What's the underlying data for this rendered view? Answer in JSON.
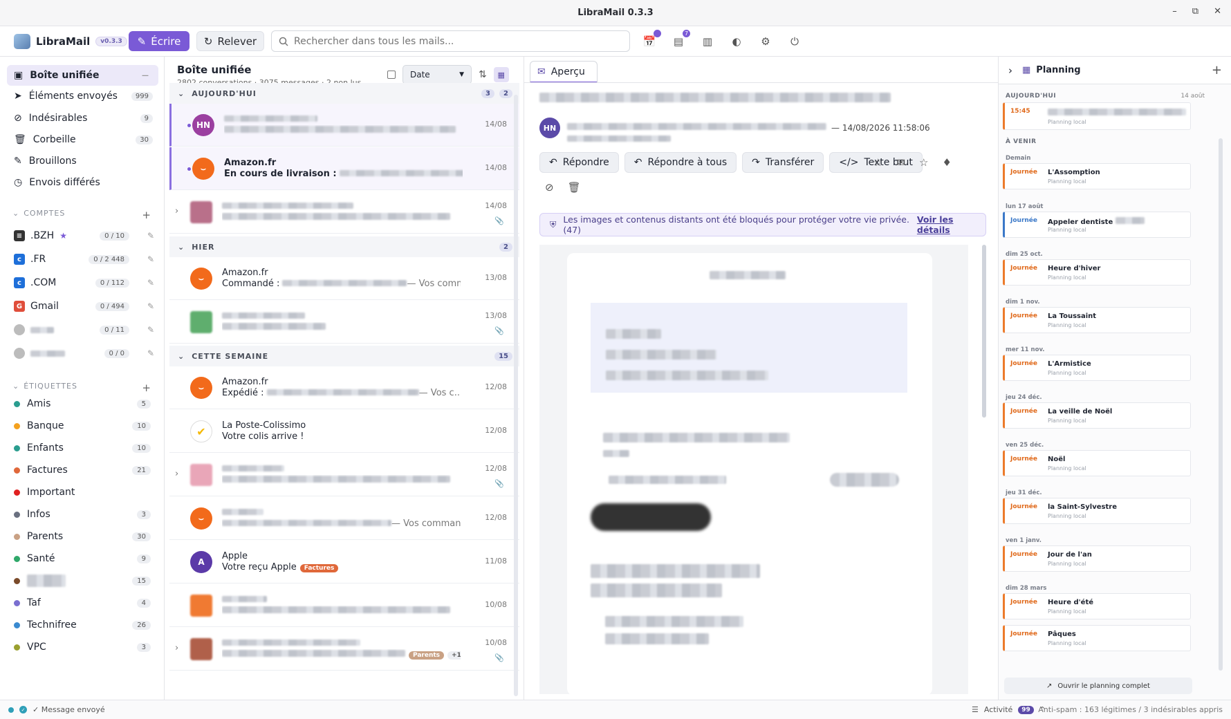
{
  "window": {
    "title": "LibraMail 0.3.3"
  },
  "toolbar": {
    "app_name": "LibraMail",
    "version": "v0.3.3",
    "write_label": "Écrire",
    "fetch_label": "Relever",
    "search_placeholder": "Rechercher dans tous les mails...",
    "calendar_badge": "",
    "tasks_badge": "7"
  },
  "sidebar": {
    "folders": [
      {
        "label": "Boîte unifiée",
        "count": ""
      },
      {
        "label": "Éléments envoyés",
        "count": "999"
      },
      {
        "label": "Indésirables",
        "count": "9"
      },
      {
        "label": "Corbeille",
        "count": "30"
      },
      {
        "label": "Brouillons",
        "count": ""
      },
      {
        "label": "Envois différés",
        "count": ""
      }
    ],
    "accounts_title": "COMPTES",
    "accounts": [
      {
        "label": ".BZH",
        "count": "0 / 10",
        "color": "#333333"
      },
      {
        "label": ".FR",
        "count": "0 / 2 448",
        "color": "#1e6fd9"
      },
      {
        "label": ".COM",
        "count": "0 / 112",
        "color": "#1e6fd9"
      },
      {
        "label": "Gmail",
        "count": "0 / 494",
        "color": "#e04e3b"
      },
      {
        "label": "",
        "count": "0 / 11",
        "color": "#b9b9b9"
      },
      {
        "label": "",
        "count": "0 / 0",
        "color": "#b9b9b9"
      }
    ],
    "labels_title": "ÉTIQUETTES",
    "labels": [
      {
        "label": "Amis",
        "count": "5",
        "color": "#2a9d8f"
      },
      {
        "label": "Banque",
        "count": "10",
        "color": "#f4a11e"
      },
      {
        "label": "Enfants",
        "count": "10",
        "color": "#2a9d8f"
      },
      {
        "label": "Factures",
        "count": "21",
        "color": "#e0683a"
      },
      {
        "label": "Important",
        "count": "",
        "color": "#e02020"
      },
      {
        "label": "Infos",
        "count": "3",
        "color": "#6a7080"
      },
      {
        "label": "Parents",
        "count": "30",
        "color": "#c9a184"
      },
      {
        "label": "Santé",
        "count": "9",
        "color": "#2fa86a"
      },
      {
        "label": "",
        "count": "15",
        "color": "#7a4a2a"
      },
      {
        "label": "Taf",
        "count": "4",
        "color": "#7a6fd0"
      },
      {
        "label": "Technifree",
        "count": "26",
        "color": "#3a8ad0"
      },
      {
        "label": "VPC",
        "count": "3",
        "color": "#9aa030"
      }
    ]
  },
  "list": {
    "title": "Boîte unifiée",
    "subtitle": "2802 conversations · 3075 messages · 2 non lus",
    "sort_label": "Date",
    "groups": [
      {
        "label": "AUJOURD'HUI",
        "count_a": "3",
        "count_b": "2"
      },
      {
        "label": "HIER",
        "count_a": "2"
      },
      {
        "label": "CETTE SEMAINE",
        "count_a": "15"
      }
    ],
    "rows": [
      {
        "initials": "HN",
        "from": "",
        "subject": "",
        "date": "14/08"
      },
      {
        "initials": "",
        "from": "Amazon.fr",
        "subject": "En cours de livraison :",
        "date": "14/08"
      },
      {
        "initials": "",
        "from": "",
        "subject": "",
        "date": "14/08"
      },
      {
        "initials": "",
        "from": "Amazon.fr",
        "subject": "Commandé :",
        "suffix": "— Vos commande...",
        "date": "13/08"
      },
      {
        "initials": "",
        "from": "",
        "subject": "",
        "date": "13/08"
      },
      {
        "initials": "",
        "from": "Amazon.fr",
        "subject": "Expédié :",
        "suffix": "— Vos c...",
        "date": "12/08"
      },
      {
        "initials": "",
        "from": "La Poste-Colissimo",
        "subject": "Votre colis arrive !",
        "date": "12/08"
      },
      {
        "initials": "",
        "from": "",
        "subject": "",
        "date": "12/08"
      },
      {
        "initials": "",
        "from": "",
        "subject": "",
        "suffix": "— Vos commandes ...",
        "date": "12/08"
      },
      {
        "initials": "A",
        "from": "Apple",
        "subject": "Votre reçu Apple",
        "tag": "Factures",
        "date": "11/08"
      },
      {
        "initials": "",
        "from": "",
        "subject": "",
        "date": "10/08"
      },
      {
        "initials": "",
        "from": "",
        "subject": "",
        "tag": "Parents",
        "extra": "+1",
        "date": "10/08"
      }
    ]
  },
  "preview": {
    "tab_label": "Aperçu",
    "sender_initials": "HN",
    "date": "— 14/08/2026 11:58:06",
    "actions": [
      "Répondre",
      "Répondre à tous",
      "Transférer",
      "Texte brut"
    ],
    "privacy_text": "Les images et contenus distants ont été bloqués pour protéger votre vie privée. (47)",
    "privacy_link": "Voir les détails"
  },
  "planning": {
    "title": "Planning",
    "today_label": "AUJOURD'HUI",
    "today_date": "14 août",
    "today_event": {
      "time": "15:45",
      "cal": "Planning local"
    },
    "upcoming_label": "À VENIR",
    "events": [
      {
        "day": "Demain",
        "kind": "Journée",
        "name": "L'Assomption",
        "cal": "Planning local"
      },
      {
        "day": "lun 17 août",
        "kind": "Journée",
        "name": "Appeler dentiste",
        "cal": "Planning local"
      },
      {
        "day": "dim 25 oct.",
        "kind": "Journée",
        "name": "Heure d'hiver",
        "cal": "Planning local"
      },
      {
        "day": "dim 1 nov.",
        "kind": "Journée",
        "name": "La Toussaint",
        "cal": "Planning local"
      },
      {
        "day": "mer 11 nov.",
        "kind": "Journée",
        "name": "L'Armistice",
        "cal": "Planning local"
      },
      {
        "day": "jeu 24 déc.",
        "kind": "Journée",
        "name": "La veille de Noël",
        "cal": "Planning local"
      },
      {
        "day": "ven 25 déc.",
        "kind": "Journée",
        "name": "Noël",
        "cal": "Planning local"
      },
      {
        "day": "jeu 31 déc.",
        "kind": "Journée",
        "name": "la Saint-Sylvestre",
        "cal": "Planning local"
      },
      {
        "day": "ven 1 janv.",
        "kind": "Journée",
        "name": "Jour de l'an",
        "cal": "Planning local"
      },
      {
        "day": "dim 28 mars",
        "kind": "Journée",
        "name": "Heure d'été",
        "cal": "Planning local"
      },
      {
        "day": "",
        "kind": "Journée",
        "name": "Pâques",
        "cal": "Planning local"
      }
    ],
    "open_label": "Ouvrir le planning complet"
  },
  "status": {
    "message": "✓ Message envoyé",
    "activity": "Activité",
    "activity_count": "99",
    "antispam": "Anti-spam : 163 légitimes / 3 indésirables appris"
  }
}
